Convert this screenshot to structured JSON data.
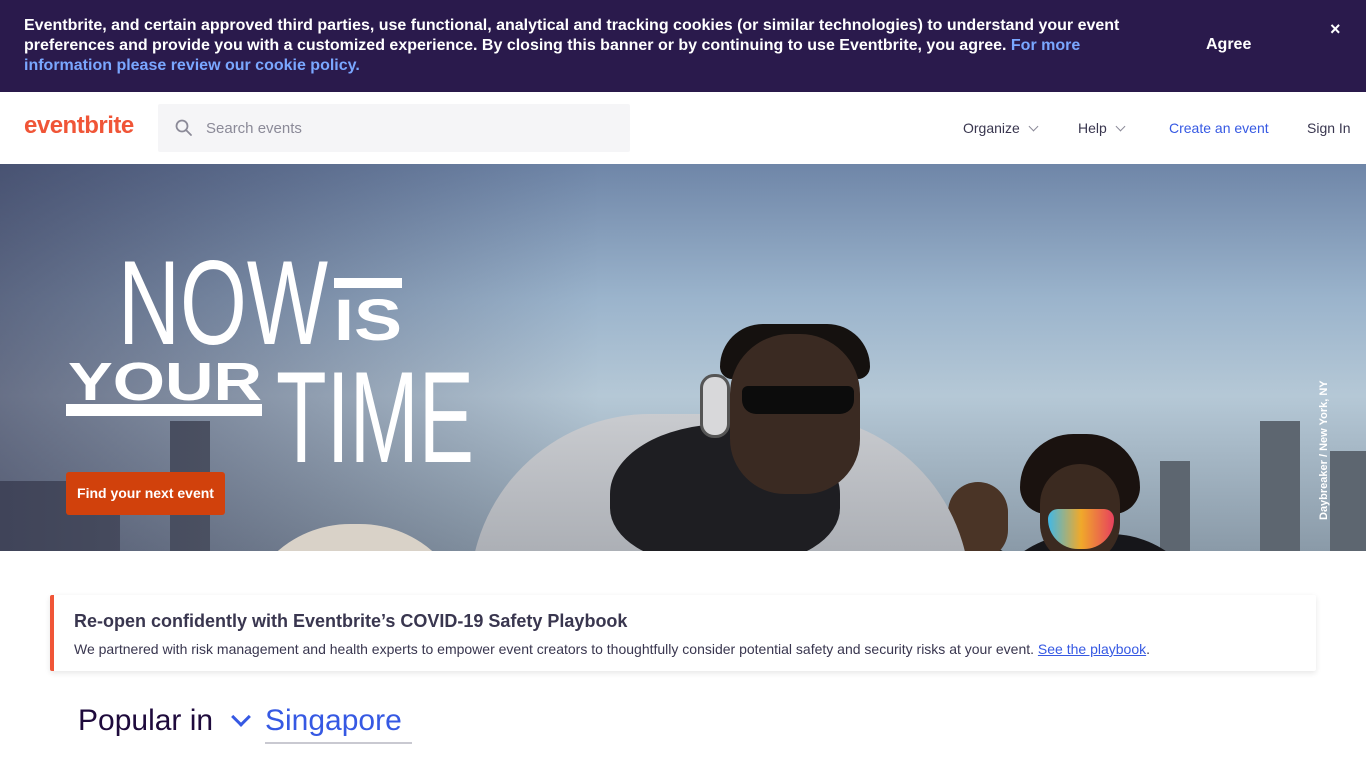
{
  "cookie_banner": {
    "text": "Eventbrite, and certain approved third parties, use functional, analytical and tracking cookies (or similar technologies) to understand your event preferences and provide you with a customized experience. By closing this banner or by continuing to use Eventbrite, you agree. ",
    "link_text": "For more information please review our cookie policy.",
    "agree_label": "Agree",
    "close_label": "×"
  },
  "header": {
    "logo": "eventbrite",
    "search_placeholder": "Search events",
    "nav": {
      "organize": "Organize",
      "help": "Help",
      "create_event": "Create an event",
      "sign_in": "Sign In"
    }
  },
  "hero": {
    "word_now": "NOW",
    "word_is": "IS",
    "word_your": "YOUR",
    "word_time": "TIME",
    "cta_label": "Find your next event",
    "photo_credit": "Daybreaker / New York, NY"
  },
  "covid_banner": {
    "title": "Re-open confidently with Eventbrite’s COVID-19 Safety Playbook",
    "body": "We partnered with risk management and health experts to empower event creators to thoughtfully consider potential safety and security risks at your event. ",
    "link_text": "See the playbook",
    "end_punct": "."
  },
  "popular": {
    "label": "Popular in",
    "location": "Singapore"
  },
  "colors": {
    "brand": "#f05537",
    "cookie_bg": "#2a1a4c",
    "link_blue": "#3659e3",
    "cta_orange": "#d1410c"
  }
}
